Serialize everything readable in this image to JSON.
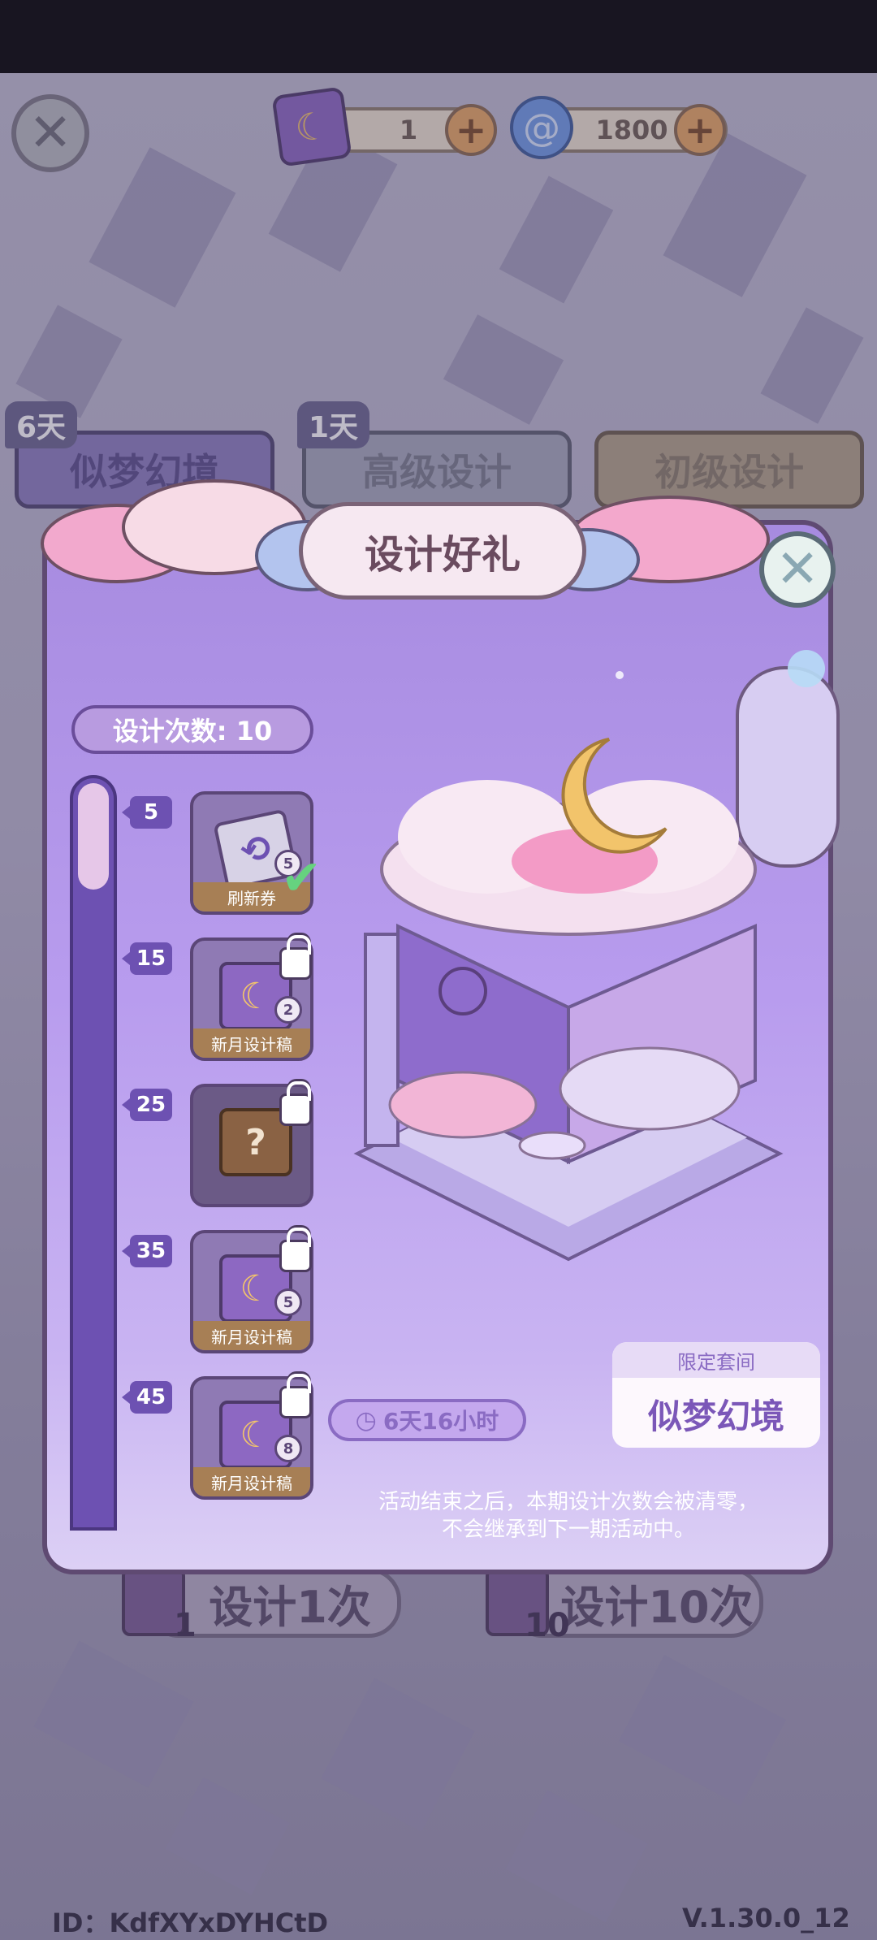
{
  "top_bar": {
    "ticket_count": "1",
    "gem_count": "1800",
    "plus_symbol": "+",
    "close_symbol": "✕"
  },
  "bg_tabs": [
    {
      "label": "似梦幻境",
      "days": "6天"
    },
    {
      "label": "高级设计",
      "days": "1天"
    },
    {
      "label": "初级设计",
      "days": ""
    }
  ],
  "bg_buttons": [
    {
      "label": "设计1次",
      "count": "1"
    },
    {
      "label": "设计10次",
      "count": "10"
    }
  ],
  "footer": {
    "user_id": "ID：KdfXYxDYHCtD",
    "version": "V.1.30.0_12"
  },
  "modal": {
    "title": "设计好礼",
    "close_symbol": "✕",
    "design_count_label": "设计次数: 10",
    "progress_fraction": 0.1,
    "milestones": [
      {
        "threshold": "5",
        "item": "刷新券",
        "qty": "5",
        "claimed": true,
        "locked": false,
        "icon": "refresh-ticket-icon"
      },
      {
        "threshold": "15",
        "item": "新月设计稿",
        "qty": "2",
        "claimed": false,
        "locked": true,
        "icon": "new-moon-scroll-icon"
      },
      {
        "threshold": "25",
        "item": "",
        "qty": "",
        "claimed": false,
        "locked": true,
        "icon": "mystery-box-icon"
      },
      {
        "threshold": "35",
        "item": "新月设计稿",
        "qty": "5",
        "claimed": false,
        "locked": true,
        "icon": "new-moon-scroll-icon"
      },
      {
        "threshold": "45",
        "item": "新月设计稿",
        "qty": "8",
        "claimed": false,
        "locked": true,
        "icon": "new-moon-scroll-icon"
      }
    ],
    "timer": "6天16小时",
    "set_card": {
      "caption": "限定套间",
      "name": "似梦幻境"
    },
    "notice_line1": "活动结束之后，本期设计次数会被清零，",
    "notice_line2": "不会继承到下一期活动中。"
  },
  "colors": {
    "modal_purple": "#b89cee",
    "track_purple": "#6d51b2",
    "claimed_check": "#66d27f",
    "plus_orange": "#e9a862"
  }
}
